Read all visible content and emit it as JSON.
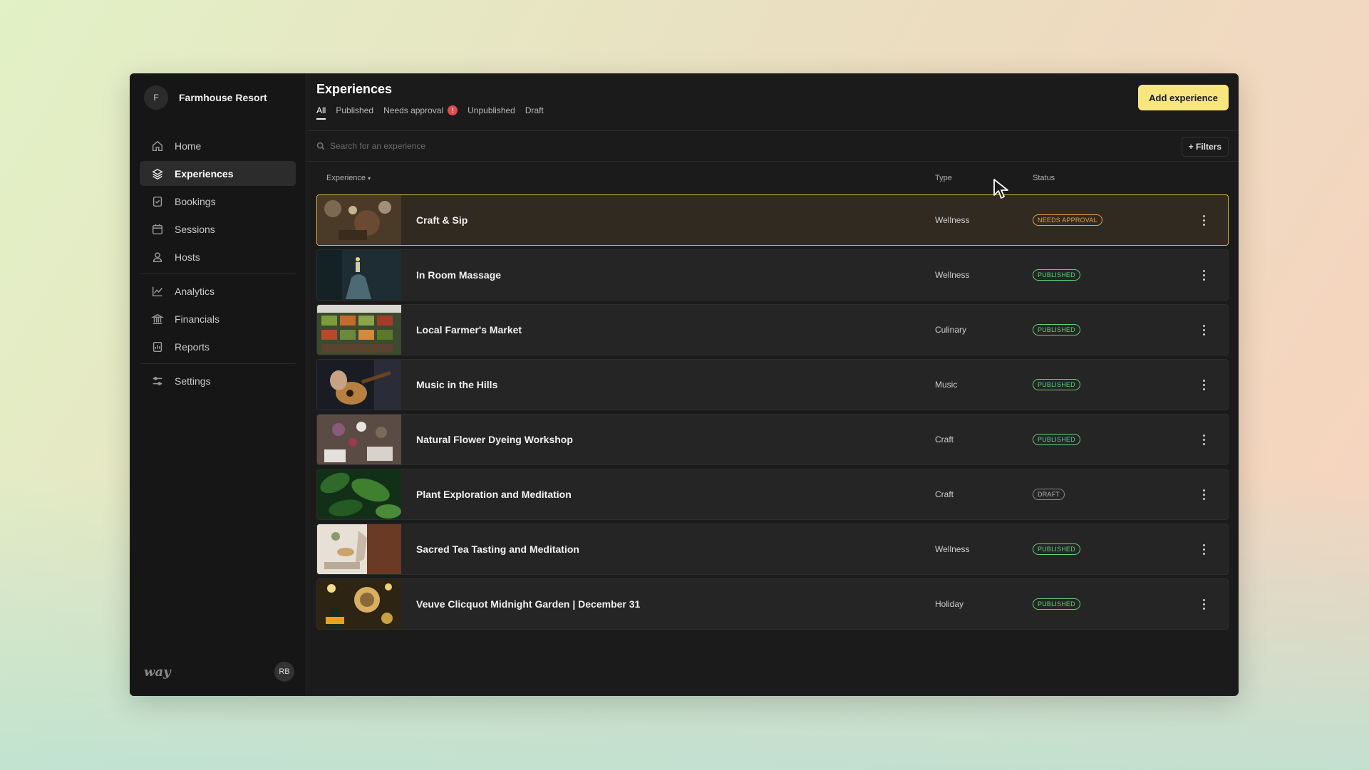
{
  "colors": {
    "accent": "#f7e57e",
    "published": "#5fd37a",
    "needs_approval": "#e9a04a",
    "draft": "#8a8a8a",
    "selected_border": "#d8b24a",
    "alert_badge": "#e44a4a"
  },
  "org": {
    "initial": "F",
    "name": "Farmhouse Resort"
  },
  "sidebar": {
    "items": [
      {
        "label": "Home",
        "icon": "home-icon"
      },
      {
        "label": "Experiences",
        "icon": "layers-icon",
        "active": true
      },
      {
        "label": "Bookings",
        "icon": "bookings-icon"
      },
      {
        "label": "Sessions",
        "icon": "calendar-icon"
      },
      {
        "label": "Hosts",
        "icon": "user-icon"
      },
      {
        "label": "Analytics",
        "icon": "chart-icon"
      },
      {
        "label": "Financials",
        "icon": "bank-icon"
      },
      {
        "label": "Reports",
        "icon": "report-icon"
      },
      {
        "label": "Settings",
        "icon": "sliders-icon"
      }
    ],
    "footer_logo": "way",
    "user_initials": "RB"
  },
  "header": {
    "title": "Experiences",
    "add_button": "Add experience",
    "tabs": [
      {
        "label": "All",
        "active": true
      },
      {
        "label": "Published"
      },
      {
        "label": "Needs approval",
        "badge": "!"
      },
      {
        "label": "Unpublished"
      },
      {
        "label": "Draft"
      }
    ]
  },
  "search": {
    "placeholder": "Search for an experience",
    "filters_label": "Filters"
  },
  "table": {
    "columns": {
      "experience": "Experience",
      "type": "Type",
      "status": "Status"
    },
    "rows": [
      {
        "name": "Craft & Sip",
        "type": "Wellness",
        "status": "NEEDS APPROVAL",
        "status_kind": "need",
        "selected": true,
        "thumb": "craft-thumbnail"
      },
      {
        "name": "In Room Massage",
        "type": "Wellness",
        "status": "PUBLISHED",
        "status_kind": "pub",
        "thumb": "massage-thumbnail"
      },
      {
        "name": "Local Farmer's Market",
        "type": "Culinary",
        "status": "PUBLISHED",
        "status_kind": "pub",
        "thumb": "market-thumbnail"
      },
      {
        "name": "Music in the Hills",
        "type": "Music",
        "status": "PUBLISHED",
        "status_kind": "pub",
        "thumb": "guitar-thumbnail"
      },
      {
        "name": "Natural Flower Dyeing Workshop",
        "type": "Craft",
        "status": "PUBLISHED",
        "status_kind": "pub",
        "thumb": "flower-thumbnail"
      },
      {
        "name": "Plant Exploration and Meditation",
        "type": "Craft",
        "status": "DRAFT",
        "status_kind": "draft",
        "thumb": "plant-thumbnail"
      },
      {
        "name": "Sacred Tea Tasting and Meditation",
        "type": "Wellness",
        "status": "PUBLISHED",
        "status_kind": "pub",
        "thumb": "tea-thumbnail"
      },
      {
        "name": "Veuve Clicquot Midnight Garden | December 31",
        "type": "Holiday",
        "status": "PUBLISHED",
        "status_kind": "pub",
        "thumb": "champagne-thumbnail"
      }
    ]
  }
}
